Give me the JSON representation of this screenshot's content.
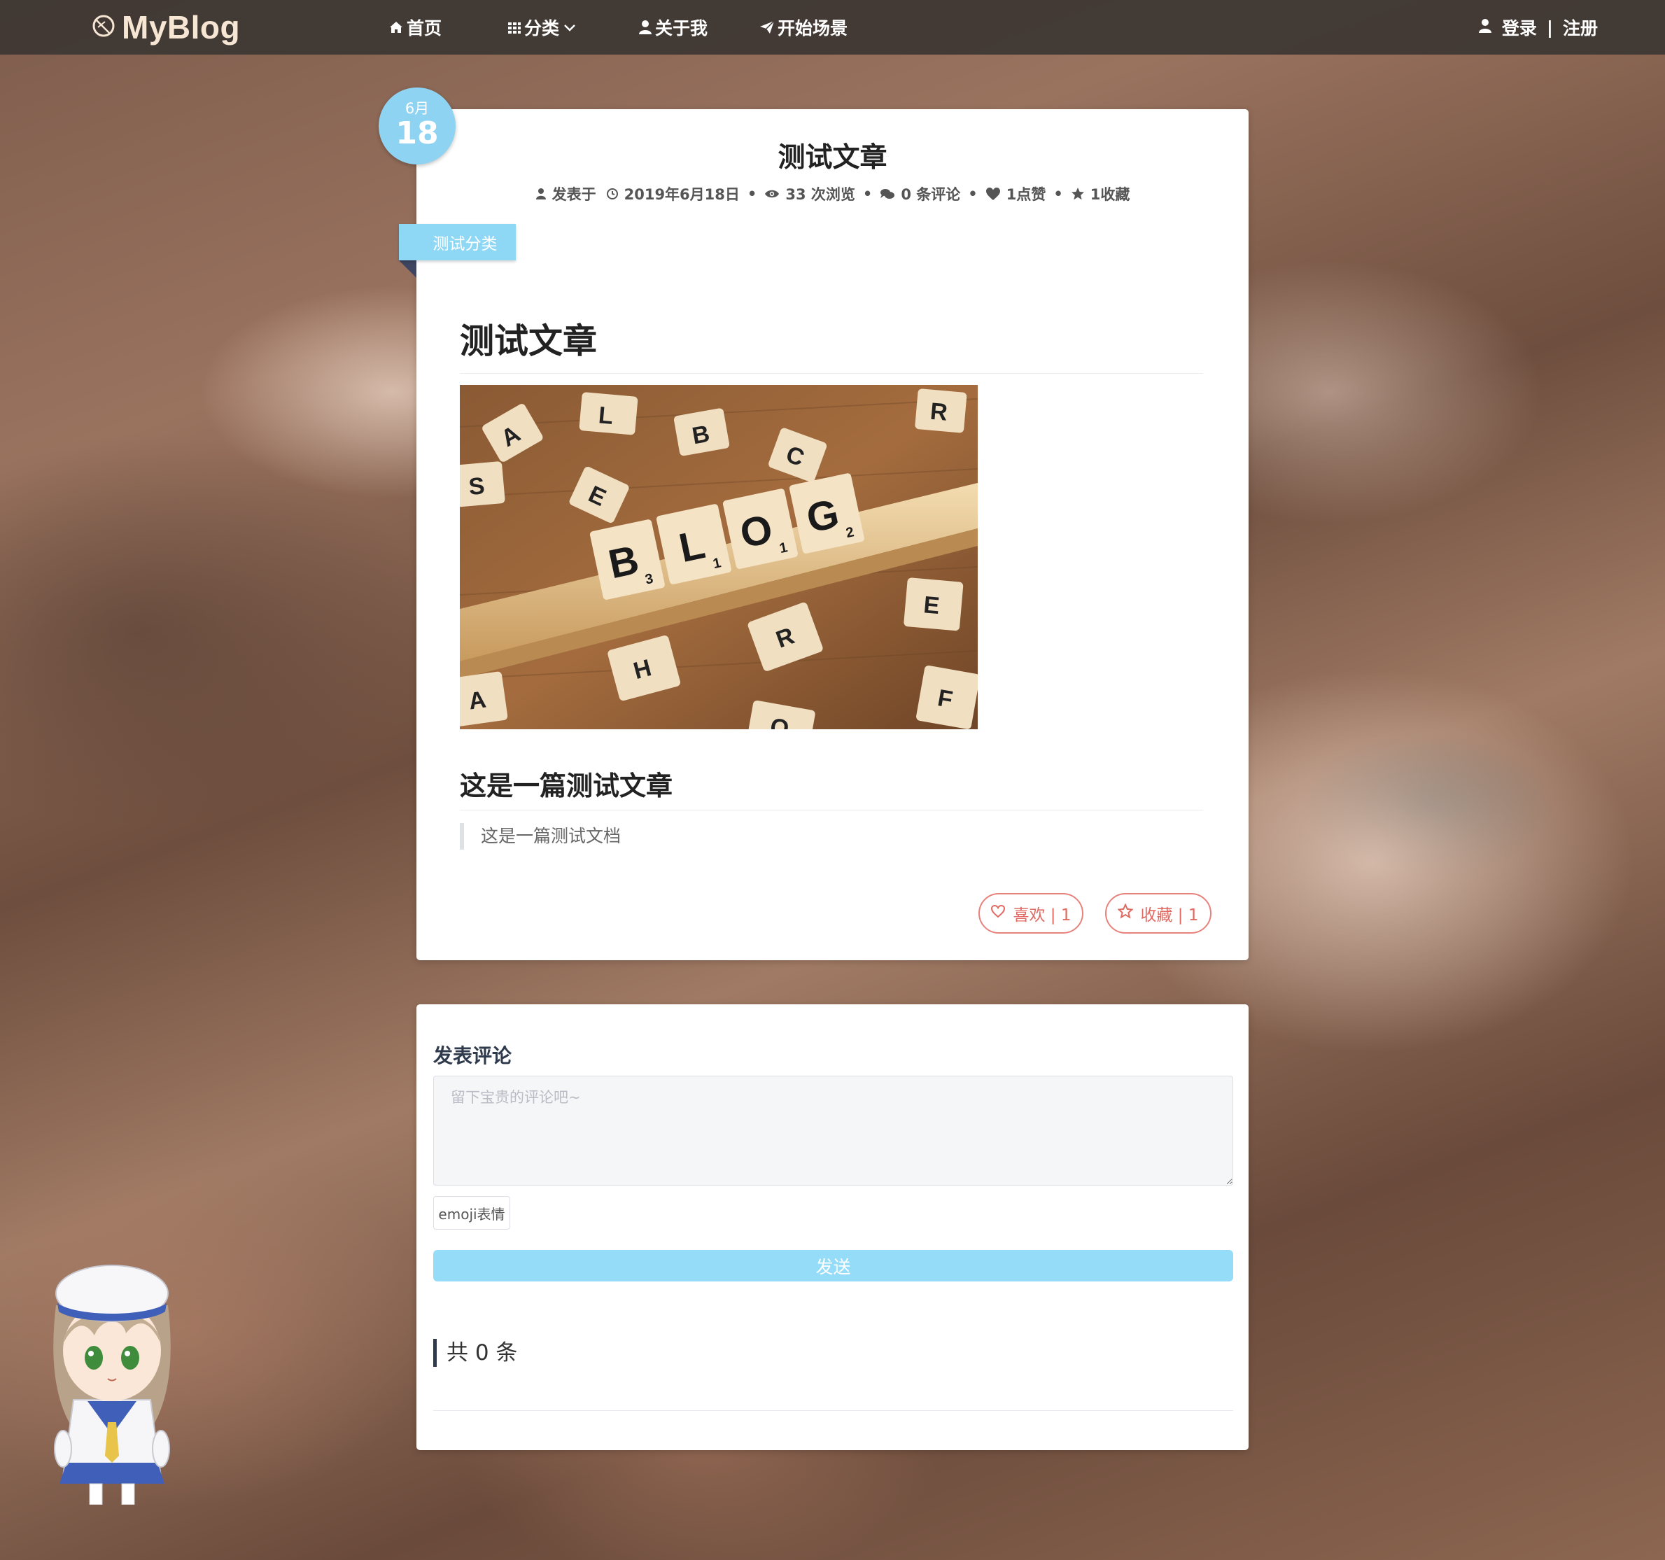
{
  "navbar": {
    "brand": "MyBlog",
    "items": [
      {
        "label": "首页",
        "icon": "home-icon"
      },
      {
        "label": "分类",
        "icon": "grid-icon",
        "dropdown": true
      },
      {
        "label": "关于我",
        "icon": "user-icon"
      },
      {
        "label": "开始场景",
        "icon": "paper-plane-icon"
      }
    ],
    "login": "登录",
    "separator": "|",
    "register": "注册"
  },
  "article": {
    "date_month": "6月",
    "date_day": "18",
    "title": "测试文章",
    "meta": {
      "posted_label": "发表于",
      "date": "2019年6月18日",
      "views": "33 次浏览",
      "comments": "0 条评论",
      "likes": "1点赞",
      "favorites": "1收藏",
      "bullet": "•"
    },
    "category": "测试分类",
    "content_heading": "测试文章",
    "image": {
      "tiles_upright": [
        "B",
        "L",
        "O",
        "G"
      ],
      "tiles_subscripts": [
        "3",
        "1",
        "1",
        "2"
      ],
      "tiles_scattered": [
        "A",
        "L",
        "B",
        "R",
        "C",
        "S",
        "E",
        "E",
        "H",
        "R",
        "F",
        "A",
        "O"
      ]
    },
    "content_subheading": "这是一篇测试文章",
    "quote": "这是一篇测试文档",
    "like_button": "喜欢 | 1",
    "favorite_button": "收藏 | 1"
  },
  "comment": {
    "title": "发表评论",
    "placeholder": "留下宝贵的评论吧~",
    "emoji_button": "emoji表情",
    "send_button": "发送",
    "count": "共 0 条"
  },
  "colors": {
    "accent": "#8fd3f2",
    "send": "#95dcf8",
    "like": "#e06a62",
    "navbar": "#3e3733"
  }
}
